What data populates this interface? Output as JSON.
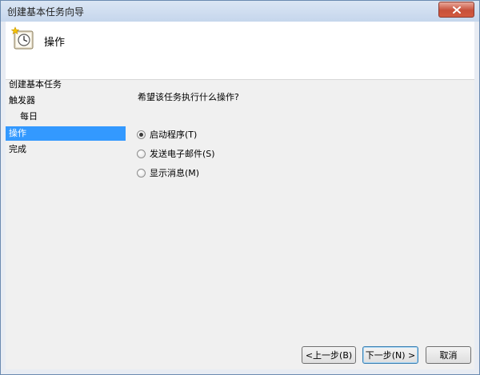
{
  "window": {
    "title": "创建基本任务向导"
  },
  "header": {
    "title": "操作"
  },
  "nav": {
    "items": [
      {
        "label": "创建基本任务"
      },
      {
        "label": "触发器"
      },
      {
        "label": "每日"
      },
      {
        "label": "操作"
      },
      {
        "label": "完成"
      }
    ]
  },
  "main": {
    "question": "希望该任务执行什么操作?",
    "options": [
      {
        "label": "启动程序(T)",
        "checked": true
      },
      {
        "label": "发送电子邮件(S)",
        "checked": false
      },
      {
        "label": "显示消息(M)",
        "checked": false
      }
    ]
  },
  "buttons": {
    "back": "<上一步(B)",
    "next": "下一步(N) >",
    "cancel": "取消"
  },
  "colors": {
    "selection": "#3399ff",
    "titlebar": "#c5d6ec",
    "close": "#c7503a"
  },
  "icons": {
    "close": "close-icon",
    "task": "clock-task-icon"
  }
}
